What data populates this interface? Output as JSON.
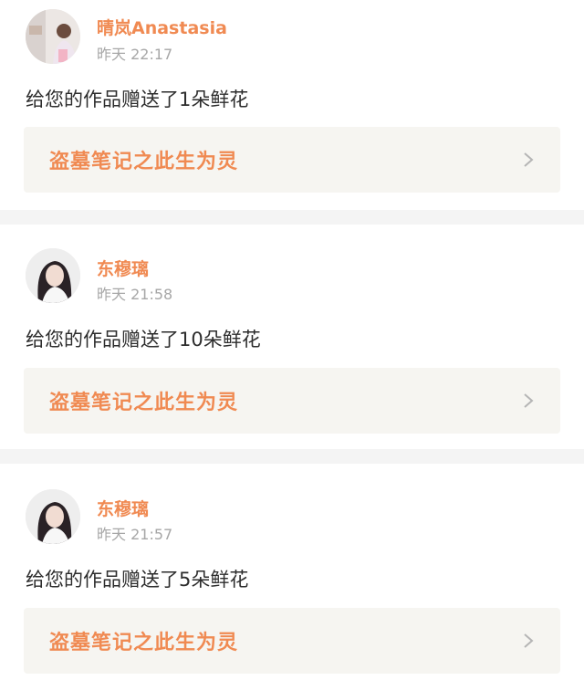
{
  "notifications": [
    {
      "user": "晴岚Anastasia",
      "time": "昨天 22:17",
      "message": "给您的作品赠送了1朵鲜花",
      "work_title": "盗墓笔记之此生为灵",
      "avatar_icon": "user-avatar-photo"
    },
    {
      "user": "东穆璃",
      "time": "昨天 21:58",
      "message": "给您的作品赠送了10朵鲜花",
      "work_title": "盗墓笔记之此生为灵",
      "avatar_icon": "user-avatar-photo"
    },
    {
      "user": "东穆璃",
      "time": "昨天 21:57",
      "message": "给您的作品赠送了5朵鲜花",
      "work_title": "盗墓笔记之此生为灵",
      "avatar_icon": "user-avatar-photo"
    }
  ],
  "colors": {
    "accent": "#f08a52",
    "card_background": "#f6f5f1",
    "separator": "#f4f4f4",
    "muted_text": "#a7a7a7"
  }
}
